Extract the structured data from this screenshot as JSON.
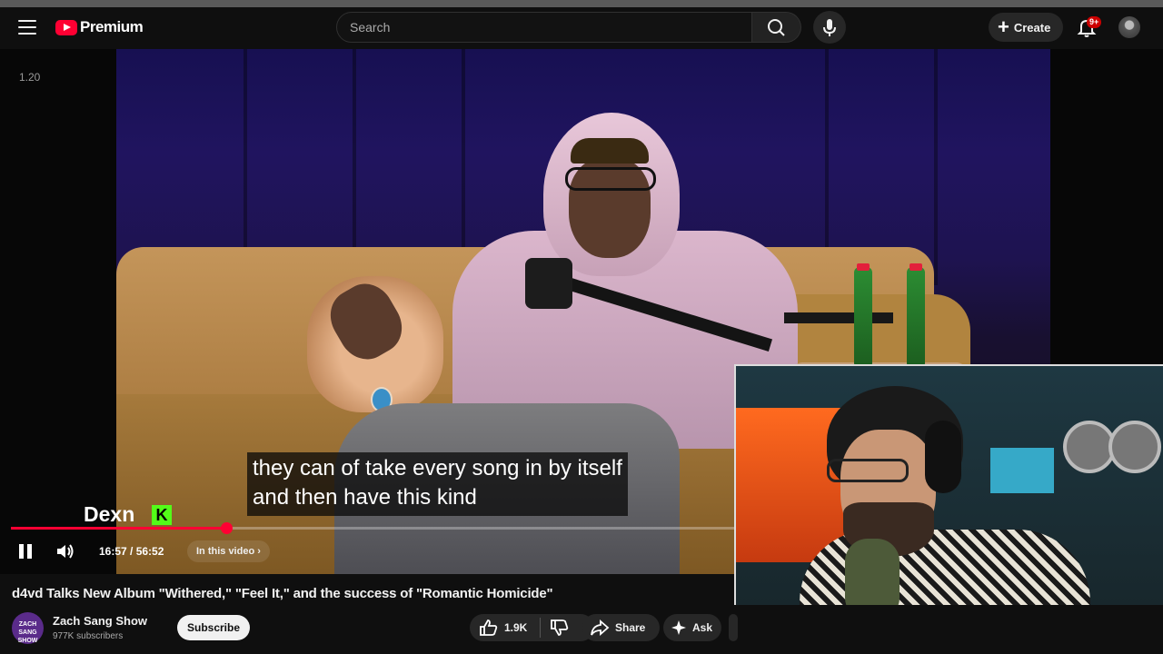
{
  "masthead": {
    "logo_text": "Premium",
    "search_placeholder": "Search",
    "create_label": "Create",
    "notifications_badge": "9+"
  },
  "player": {
    "fps_overlay": "1.20",
    "captions": [
      "they can of take every song in by itself",
      "and then have this kind"
    ],
    "streamer_name": "Dexn",
    "streamer_logo": "K",
    "time": "16:57 / 56:52",
    "in_this_video": "In this video",
    "progress": 0.298
  },
  "video": {
    "title": "d4vd Talks New Album \"Withered,\" \"Feel It,\" and the success of \"Romantic Homicide\"",
    "channel_name": "Zach Sang Show",
    "channel_avatar_text": "ZACH SANG SHOW",
    "subscribers": "977K subscribers",
    "subscribe_label": "Subscribe",
    "likes": "1.9K",
    "share_label": "Share",
    "ask_label": "Ask"
  }
}
